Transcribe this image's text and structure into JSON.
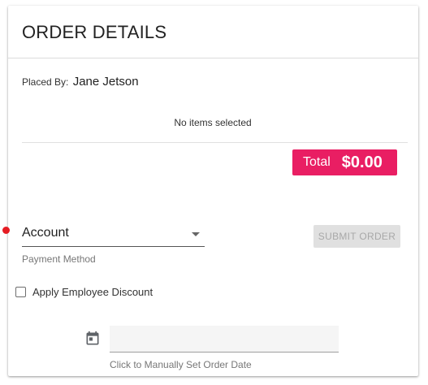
{
  "header": {
    "title": "ORDER DETAILS"
  },
  "placed_by": {
    "label": "Placed By:",
    "name": "Jane Jetson"
  },
  "items": {
    "empty_message": "No items selected"
  },
  "total": {
    "label": "Total",
    "amount": "$0.00",
    "badge_color": "#e91e63"
  },
  "payment": {
    "selected_value": "Account",
    "helper_text": "Payment Method",
    "required_indicator_color": "#e51c23"
  },
  "submit": {
    "label": "SUBMIT ORDER",
    "disabled": true
  },
  "discount": {
    "label": "Apply Employee Discount",
    "checked": false
  },
  "order_date": {
    "icon": "calendar-icon",
    "value": "",
    "helper_text": "Click to Manually Set Order Date"
  }
}
